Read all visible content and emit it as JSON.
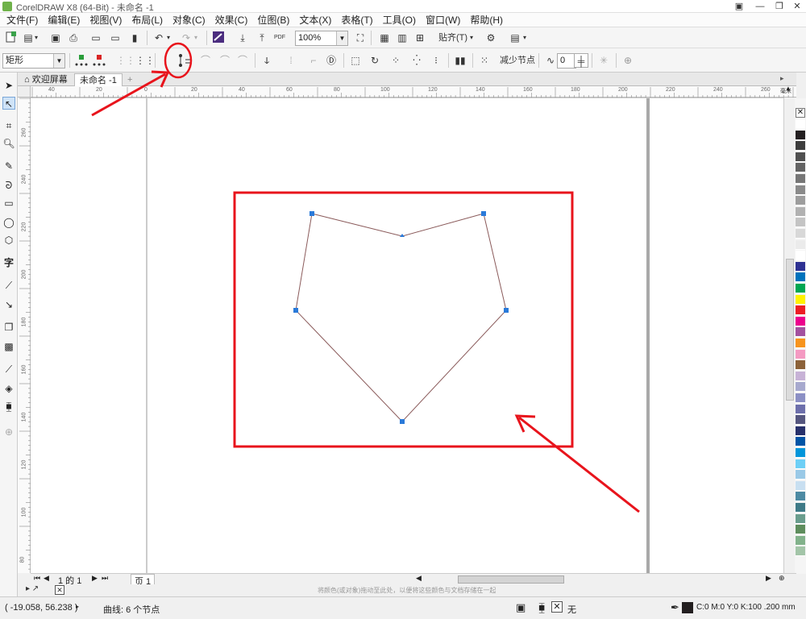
{
  "window": {
    "title": "CorelDRAW X8 (64-Bit) - 未命名 -1"
  },
  "menu": [
    "文件(F)",
    "编辑(E)",
    "视图(V)",
    "布局(L)",
    "对象(C)",
    "效果(C)",
    "位图(B)",
    "文本(X)",
    "表格(T)",
    "工具(O)",
    "窗口(W)",
    "帮助(H)"
  ],
  "toolbar": {
    "zoom_value": "100%",
    "snap_label": "贴齐(T)",
    "pdf_label": "PDF"
  },
  "property_bar": {
    "object_type": "矩形",
    "reduce_nodes_label": "减少节点",
    "smooth_value": "0"
  },
  "tabs": {
    "welcome_label": "欢迎屏幕",
    "doc_label": "未命名 -1",
    "add_label": "+"
  },
  "ruler": {
    "h_labels": [
      "40",
      "20",
      "0",
      "20",
      "40",
      "60",
      "80",
      "100",
      "120",
      "140",
      "160",
      "180",
      "200",
      "220",
      "240",
      "260"
    ],
    "v_labels": [
      "260",
      "240",
      "220",
      "200",
      "180",
      "160",
      "140",
      "120",
      "100",
      "80",
      "60"
    ],
    "unit": "毫米"
  },
  "page_nav": {
    "page_counter": "1 的 1",
    "page_tab": "页 1"
  },
  "color_hint": "将颜色(或对象)拖动至此处，以便将这些颜色与文档存储在一起",
  "status": {
    "coords": "( -19.058, 56.238 )",
    "selection_info": "曲线: 6 个节点",
    "fill_none": "无",
    "outline_info": "C:0 M:0 Y:0 K:100  .200 mm"
  },
  "colors": {
    "annotation": "#e8141c",
    "node": "#2a7ad9",
    "palette": [
      "#ffffff",
      "#231f20",
      "#3d3d3d",
      "#505050",
      "#636363",
      "#767676",
      "#8a8a8a",
      "#9d9d9d",
      "#b1b1b1",
      "#c4c4c4",
      "#d8d8d8",
      "#ebebeb",
      "#ffffff",
      "#2e3192",
      "#0072bc",
      "#00a651",
      "#fff200",
      "#ed1c24",
      "#ec008c",
      "#a3519f",
      "#f7941d",
      "#f49ac2",
      "#8c6239",
      "#c7b2d6",
      "#a7a9ce",
      "#8b8fc4",
      "#6d6fab",
      "#55567f",
      "#27306b",
      "#0054a6",
      "#0095da",
      "#6dcff6",
      "#9ac9e7",
      "#c8dff1",
      "#4d8aa3",
      "#3e7a87",
      "#6a9d8d",
      "#5e8d5d",
      "#82b28b",
      "#a3c5a8"
    ]
  }
}
